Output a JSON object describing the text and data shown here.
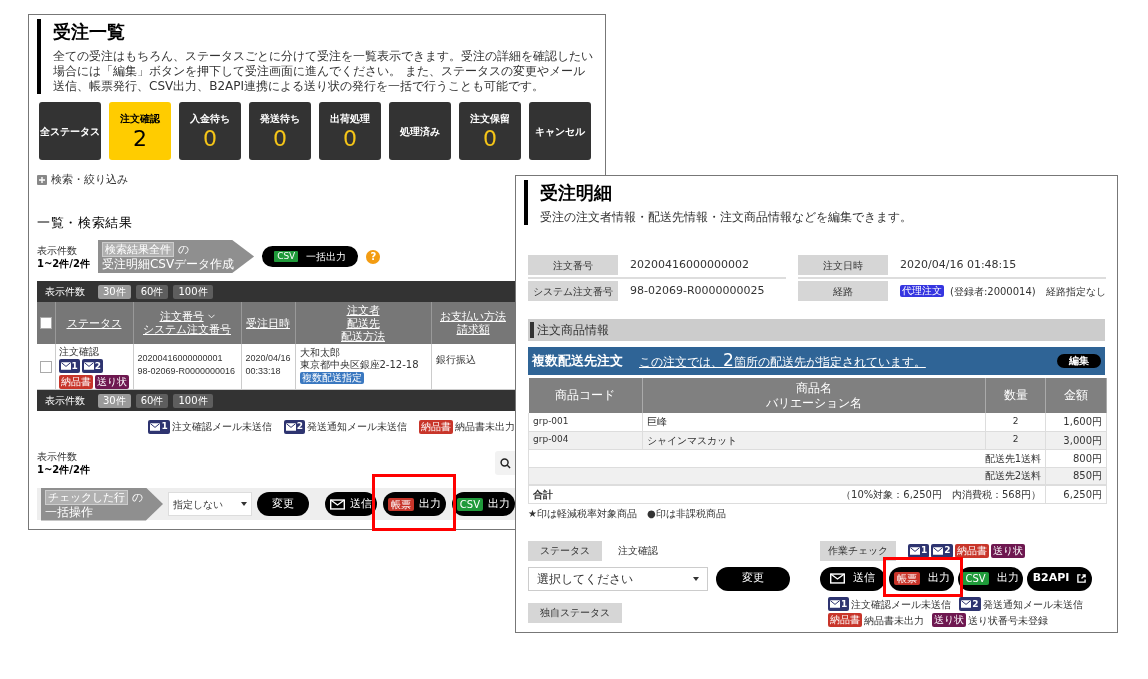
{
  "list_page": {
    "title": "受注一覧",
    "description": "全ての受注はもちろん、ステータスごとに分けて受注を一覧表示できます。受注の詳細を確認したい場合には「編集」ボタンを押下して受注画面に進んでください。 また、ステータスの変更やメール送信、帳票発行、CSV出力、B2API連携による送り状の発行を一括で行うことも可能です。",
    "status_tiles": [
      {
        "label": "全ステータス",
        "selected": false
      },
      {
        "label": "注文確認",
        "count": "2",
        "selected": true
      },
      {
        "label": "入金待ち",
        "count": "0",
        "selected": false
      },
      {
        "label": "発送待ち",
        "count": "0",
        "selected": false
      },
      {
        "label": "出荷処理",
        "count": "0",
        "selected": false
      },
      {
        "label": "処理済み",
        "selected": false
      },
      {
        "label": "注文保留",
        "count": "0",
        "selected": false
      },
      {
        "label": "キャンセル",
        "selected": false
      }
    ],
    "search_toggle": "検索・絞り込み",
    "results_heading": "一覧・検索結果",
    "result_count": {
      "label": "表示件数",
      "value": "1~2件/2件"
    },
    "csv_step": {
      "tag": "検索結果全件",
      "suffix": "の",
      "text": "受注明細CSVデータ作成"
    },
    "csv_button": {
      "badge": "CSV",
      "label": "一括出力"
    },
    "help": "?",
    "per_page_bars": [
      {
        "label": "表示件数",
        "options": [
          {
            "label": "30件",
            "selected": true
          },
          {
            "label": "60件",
            "selected": false
          },
          {
            "label": "100件",
            "selected": false
          }
        ]
      },
      {
        "label": "表示件数",
        "options": [
          {
            "label": "30件",
            "selected": true
          },
          {
            "label": "60件",
            "selected": false
          },
          {
            "label": "100件",
            "selected": false
          }
        ]
      }
    ],
    "table": {
      "select_all_checked": false,
      "columns": [
        {
          "lines": [
            "ステータス"
          ],
          "sorted": false
        },
        {
          "lines": [
            "注文番号",
            "システム注文番号"
          ],
          "sorted": true
        },
        {
          "lines": [
            "受注日時"
          ],
          "sorted": false
        },
        {
          "lines": [
            "注文者",
            "配送先",
            "配送方法"
          ],
          "sorted": false
        },
        {
          "lines": [
            "お支払い方法",
            "請求額"
          ],
          "sorted": false
        }
      ],
      "rows": [
        {
          "checked": false,
          "status": "注文確認",
          "badges": [
            {
              "kind": "mail",
              "text": "1",
              "color": "#2e3470"
            },
            {
              "kind": "mail",
              "text": "2",
              "color": "#2e3470"
            },
            {
              "kind": "label",
              "text": "納品書",
              "color": "#c8352a"
            },
            {
              "kind": "label",
              "text": "送り状",
              "color": "#6e1850"
            }
          ],
          "order_no": "20200416000000001",
          "system_no": "98-02069-R0000000016",
          "date": "2020/04/16",
          "time": "00:33:18",
          "name": "大和太郎",
          "address": "東京都中央区銀座2-12-18",
          "delivery_tag": "複数配送指定",
          "payment": "銀行振込"
        }
      ]
    },
    "legend": [
      {
        "badge": {
          "kind": "mail",
          "text": "1",
          "color": "#2e3470"
        },
        "text": "注文確認メール未送信"
      },
      {
        "badge": {
          "kind": "mail",
          "text": "2",
          "color": "#2e3470"
        },
        "text": "発送通知メール未送信"
      },
      {
        "badge": {
          "kind": "label",
          "text": "納品書",
          "color": "#c8352a"
        },
        "text": "納品書未出力"
      }
    ],
    "footer_count": {
      "label": "表示件数",
      "value": "1~2件/2件"
    },
    "bulk": {
      "tag": "チェックした行",
      "suffix": "の",
      "text": "一括操作",
      "select": "指定しない",
      "change": "変更",
      "buttons": [
        {
          "kind": "mail",
          "label": "送信"
        },
        {
          "kind": "badge",
          "badge": "帳票",
          "color": "#c8352a",
          "label": "出力"
        },
        {
          "kind": "badge",
          "badge": "CSV",
          "color": "#1f9a3a",
          "label": "出力"
        }
      ]
    }
  },
  "detail_page": {
    "title": "受注明細",
    "description": "受注の注文者情報・配送先情報・注文商品情報などを編集できます。",
    "info": [
      {
        "kind": "text",
        "label": "注文番号",
        "value": "20200416000000002"
      },
      {
        "kind": "text",
        "label": "注文日時",
        "value": "2020/04/16 01:48:15"
      },
      {
        "kind": "text",
        "label": "システム注文番号",
        "value": "98-02069-R0000000025"
      },
      {
        "kind": "route",
        "label": "経路",
        "tag": "代理注文",
        "note": "(登録者:2000014)",
        "extra": "経路指定なし"
      }
    ],
    "section": "注文商品情報",
    "multi": {
      "title": "複数配送先注文",
      "link_before": "この注文では、",
      "link_count": "2",
      "link_after": "箇所の配送先が指定されています。",
      "edit": "編集"
    },
    "items_table": {
      "columns": [
        [
          "商品コード"
        ],
        [
          "商品名",
          "バリエーション名"
        ],
        [
          "数量"
        ],
        [
          "金額"
        ]
      ],
      "rows": [
        {
          "code": "grp-001",
          "name": "巨峰",
          "qty": "2",
          "amount": "1,600円"
        },
        {
          "code": "grp-004",
          "name": "シャインマスカット",
          "qty": "2",
          "amount": "3,000円"
        }
      ],
      "fees": [
        {
          "label": "配送先1送料",
          "amount": "800円"
        },
        {
          "label": "配送先2送料",
          "amount": "850円"
        }
      ],
      "total": {
        "label": "合計",
        "note": "（10%対象：6,250円　内消費税：568円）",
        "amount": "6,250円"
      }
    },
    "footnote": "★印は軽減税率対象商品　●印は非課税商品",
    "status": {
      "label": "ステータス",
      "value": "注文確認",
      "select": "選択してください",
      "change": "変更",
      "custom_label": "独自ステータス"
    },
    "work": {
      "label": "作業チェック",
      "badges": [
        {
          "kind": "mail",
          "text": "1",
          "color": "#2e3470"
        },
        {
          "kind": "mail",
          "text": "2",
          "color": "#2e3470"
        },
        {
          "kind": "label",
          "text": "納品書",
          "color": "#c8352a"
        },
        {
          "kind": "label",
          "text": "送り状",
          "color": "#6e1850"
        }
      ],
      "buttons": [
        {
          "kind": "mail",
          "label": "送信"
        },
        {
          "kind": "badge",
          "badge": "帳票",
          "color": "#c8352a",
          "label": "出力"
        },
        {
          "kind": "badge",
          "badge": "CSV",
          "color": "#1f9a3a",
          "label": "出力"
        },
        {
          "kind": "external",
          "label": "B2API"
        }
      ],
      "legend": [
        {
          "badge": {
            "kind": "mail",
            "text": "1",
            "color": "#2e3470"
          },
          "text": "注文確認メール未送信"
        },
        {
          "badge": {
            "kind": "mail",
            "text": "2",
            "color": "#2e3470"
          },
          "text": "発送通知メール未送信"
        },
        {
          "badge": {
            "kind": "label",
            "text": "納品書",
            "color": "#c8352a"
          },
          "text": "納品書未出力"
        },
        {
          "badge": {
            "kind": "label",
            "text": "送り状",
            "color": "#6e1850"
          },
          "text": "送り状番号未登録"
        }
      ]
    }
  }
}
